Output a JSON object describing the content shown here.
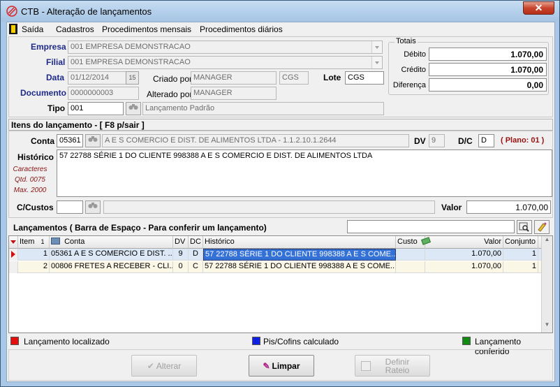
{
  "window": {
    "title": "CTB - Alteração de lançamentos",
    "close_label": "✕"
  },
  "menu": {
    "items": [
      "Saída",
      "Cadastros",
      "Procedimentos mensais",
      "Procedimentos diários"
    ]
  },
  "header": {
    "empresa_label": "Empresa",
    "empresa_value": "001 EMPRESA DEMONSTRACAO",
    "filial_label": "Filial",
    "filial_value": "001 EMPRESA DEMONSTRACAO",
    "data_label": "Data",
    "data_value": "01/12/2014",
    "calendar_label": "15",
    "criado_label": "Criado por",
    "criado_value": "MANAGER",
    "criado_code": "CGS",
    "lote_label": "Lote",
    "lote_value": "CGS",
    "documento_label": "Documento",
    "documento_value": "0000000003",
    "alterado_label": "Alterado por",
    "alterado_value": "MANAGER",
    "tipo_label": "Tipo",
    "tipo_value": "001",
    "tipo_desc": "Lançamento Padrão"
  },
  "totais": {
    "title": "Totais",
    "debito_label": "Débito",
    "debito_value": "1.070,00",
    "credito_label": "Crédito",
    "credito_value": "1.070,00",
    "diferenca_label": "Diferença",
    "diferenca_value": "0,00"
  },
  "item": {
    "section_title": "Itens do lançamento - [ F8 p/sair ]",
    "conta_label": "Conta",
    "conta_value": "05361",
    "conta_desc": "A E S COMERCIO E DIST. DE ALIMENTOS LTDA - 1.1.2.10.1.2644",
    "dv_label": "DV",
    "dv_value": "9",
    "dc_label": "D/C",
    "dc_value": "D",
    "plano_label": "( Plano: 01 )",
    "historico_label": "Histórico",
    "historico_value": "57 22788 SÉRIE 1 DO CLIENTE 998388 A E S COMERCIO E DIST. DE ALIMENTOS LTDA",
    "caracteres_label": "Caracteres",
    "qtd_label": "Qtd. 0075",
    "max_label": "Max. 2000",
    "ccustos_label": "C/Custos",
    "ccustos_value": "",
    "ccustos_desc": "",
    "valor_label": "Valor",
    "valor_value": "1.070,00"
  },
  "lancamentos": {
    "title": "Lançamentos ( Barra de Espaço - Para conferir um lançamento)",
    "search_value": "",
    "columns": [
      "Item",
      "1",
      "Conta",
      "DV",
      "DC",
      "Histórico",
      "Custo",
      "Valor",
      "Conjunto"
    ],
    "rows": [
      {
        "item": "1",
        "conta": "05361 A E S COMERCIO E DIST. ...",
        "dv": "9",
        "dc": "D",
        "historico": "57 22788 SÉRIE 1 DO CLIENTE 998388 A E S COME...",
        "custo": "",
        "valor": "1.070,00",
        "conjunto": "1"
      },
      {
        "item": "2",
        "conta": "00806 FRETES A RECEBER - CLI...",
        "dv": "0",
        "dc": "C",
        "historico": "57 22788 SÉRIE 1 DO CLIENTE 998388 A E S COME...",
        "custo": "",
        "valor": "1.070,00",
        "conjunto": "1"
      }
    ]
  },
  "legend": {
    "localizado_label": "Lançamento localizado",
    "localizado_color": "#e01010",
    "pis_label": "Pis/Cofins calculado",
    "pis_color": "#1020e0",
    "conferido_label": "Lançamento conferido",
    "conferido_color": "#108a10"
  },
  "buttons": {
    "alterar_label": "Alterar",
    "limpar_label": "Limpar",
    "rateio_label_1": "Definir",
    "rateio_label_2": "Rateio"
  }
}
